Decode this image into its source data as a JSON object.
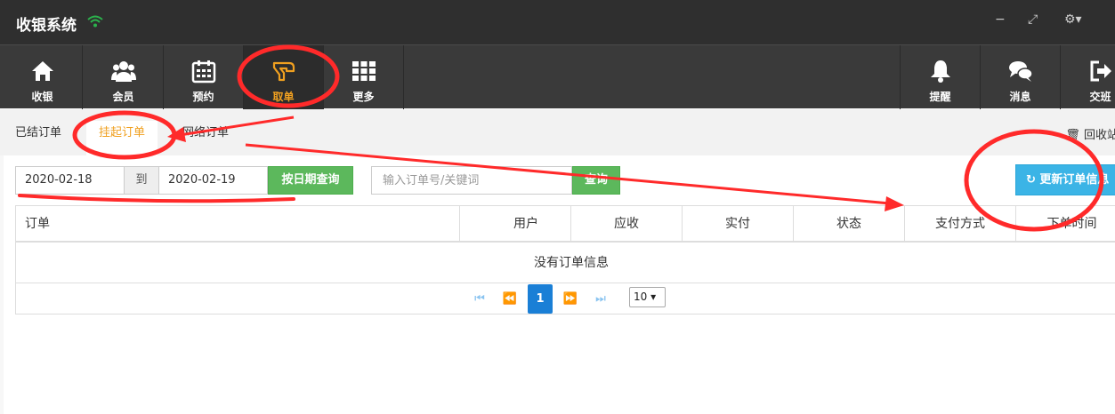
{
  "app": {
    "title": "收银系统"
  },
  "window": {
    "minimize": "−",
    "maximize": "⤢",
    "settings": "⚙▾"
  },
  "nav": {
    "left": [
      {
        "label": "收银",
        "icon": "home-icon"
      },
      {
        "label": "会员",
        "icon": "users-icon"
      },
      {
        "label": "预约",
        "icon": "calendar-icon"
      },
      {
        "label": "取单",
        "icon": "hand-icon",
        "active": true
      },
      {
        "label": "更多",
        "icon": "grid-icon"
      }
    ],
    "right": [
      {
        "label": "提醒",
        "icon": "bell-icon"
      },
      {
        "label": "消息",
        "icon": "chat-icon"
      },
      {
        "label": "交班",
        "icon": "logout-icon"
      }
    ]
  },
  "subtabs": [
    "已结订单",
    "挂起订单",
    "网络订单"
  ],
  "recycle": "🗑 回收站",
  "filter": {
    "date_from": "2020-02-18",
    "to_label": "到",
    "date_to": "2020-02-19",
    "date_query_button": "按日期查询",
    "search_placeholder": "输入订单号/关键词",
    "search_button": "查询",
    "refresh_button": "↻ 更新订单信息"
  },
  "table": {
    "columns": [
      "订单",
      "用户",
      "应收",
      "实付",
      "状态",
      "支付方式",
      "下单时间"
    ],
    "empty_message": "没有订单信息"
  },
  "pager": {
    "first": "⏮",
    "prev": "⏪",
    "current_page": "1",
    "next": "⏩",
    "last": "⏭",
    "page_size": "10 ▾"
  },
  "colors": {
    "accent": "#f0a020",
    "annotation": "#ff2a2a",
    "primary_green": "#5cb85c",
    "refresh_blue": "#3bb4e6"
  }
}
